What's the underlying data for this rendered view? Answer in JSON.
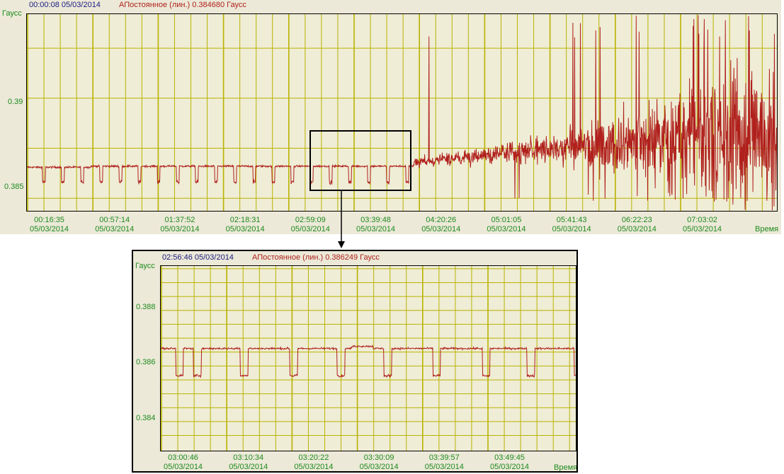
{
  "colors": {
    "grid": "#b9b200",
    "series": "#b0201c",
    "axis_text": "#1e8a1e",
    "header_time": "#1a1a80",
    "panel_bg": "#ece9d8"
  },
  "chart_data": [
    {
      "type": "line",
      "header_time": "00:00:08 05/03/2014",
      "header_series": "АПостоянное (лин.) 0.384680 Гаусс",
      "ylabel": "Гаусс",
      "xlabel": "Время",
      "ylim": [
        0.3843,
        0.3942
      ],
      "yticks": [
        "0.39",
        "0.385"
      ],
      "xticks": [
        {
          "time": "00:16:35",
          "date": "05/03/2014"
        },
        {
          "time": "00:57:14",
          "date": "05/03/2014"
        },
        {
          "time": "01:37:52",
          "date": "05/03/2014"
        },
        {
          "time": "02:18:31",
          "date": "05/03/2014"
        },
        {
          "time": "02:59:09",
          "date": "05/03/2014"
        },
        {
          "time": "03:39:48",
          "date": "05/03/2014"
        },
        {
          "time": "04:20:26",
          "date": "05/03/2014"
        },
        {
          "time": "05:01:05",
          "date": "05/03/2014"
        },
        {
          "time": "05:41:43",
          "date": "05/03/2014"
        },
        {
          "time": "06:22:23",
          "date": "05/03/2014"
        },
        {
          "time": "07:03:02",
          "date": "05/03/2014"
        }
      ],
      "grid": true,
      "series": [
        {
          "name": "АПостоянное (лин.)",
          "baseline": 0.3866,
          "dips_to": 0.3858,
          "noise_onset": "04:20:26",
          "max_spread": [
            0.3848,
            0.3942
          ]
        }
      ]
    },
    {
      "type": "line",
      "header_time": "02:56:46 05/03/2014",
      "header_series": "АПостоянное (лин.) 0.386249 Гаусс",
      "ylabel": "Гаусс",
      "xlabel": "Время",
      "ylim": [
        0.3829,
        0.3896
      ],
      "yticks": [
        "0.388",
        "0.386",
        "0.384"
      ],
      "xticks": [
        {
          "time": "03:00:46",
          "date": "05/03/2014"
        },
        {
          "time": "03:10:34",
          "date": "05/03/2014"
        },
        {
          "time": "03:20:22",
          "date": "05/03/2014"
        },
        {
          "time": "03:30:09",
          "date": "05/03/2014"
        },
        {
          "time": "03:39:57",
          "date": "05/03/2014"
        },
        {
          "time": "03:49:45",
          "date": "05/03/2014"
        }
      ],
      "grid": true,
      "series": [
        {
          "name": "АПостоянное (лин.)",
          "baseline": 0.3866,
          "dips_to": 0.3856,
          "dip_count": 10
        }
      ]
    }
  ]
}
